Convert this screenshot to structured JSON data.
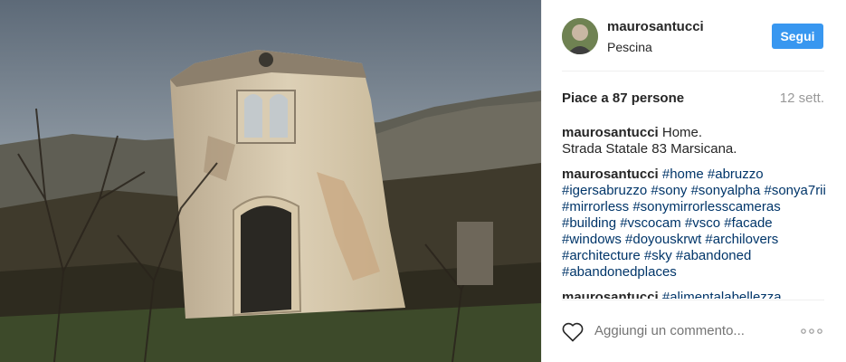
{
  "post": {
    "username": "maurosantucci",
    "location": "Pescina",
    "follow_label": "Segui",
    "likes": "Piace a 87 persone",
    "timestamp": "12 sett."
  },
  "comments": [
    {
      "user": "maurosantucci",
      "text": "Home.\nStrada Statale 83 Marsicana.",
      "hashtags": ""
    },
    {
      "user": "maurosantucci",
      "text": "",
      "hashtags": "#home #abruzzo #igersabruzzo #sony #sonyalpha #sonya7rii #mirrorless #sonymirrorlesscameras #building #vscocam #vsco #facade #windows #doyouskrwt #archilovers #architecture #sky #abandoned #abandonedplaces"
    },
    {
      "user": "maurosantucci",
      "text": "",
      "hashtags": "#alimentalabellezza"
    }
  ],
  "input": {
    "placeholder": "Aggiungi un commento..."
  },
  "colors": {
    "follow_button": "#3897f0",
    "hashtag": "#003569",
    "muted": "#999999"
  },
  "icons": {
    "like": "heart-icon",
    "more": "more-options-icon"
  }
}
